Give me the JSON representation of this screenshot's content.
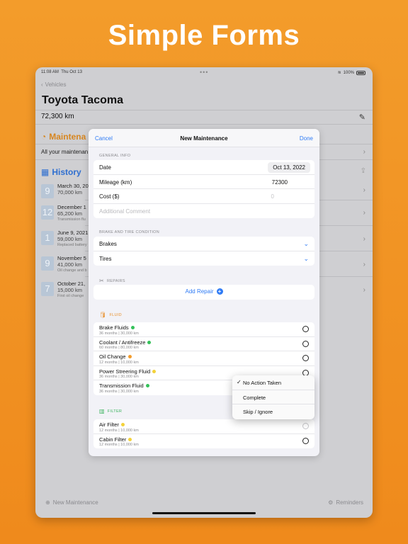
{
  "headline": "Simple Forms",
  "status": {
    "time": "11:08 AM",
    "date": "Thu Oct 13",
    "battery": "100%"
  },
  "background": {
    "back_label": "Vehicles",
    "vehicle_title": "Toyota Tacoma",
    "mileage": "72,300 km",
    "maintenance_heading": "Maintena",
    "maintenance_sub": "All your maintenan",
    "history_heading": "History",
    "history": [
      {
        "day": "9",
        "date": "March 30, 20",
        "km": "70,000 km",
        "note": ""
      },
      {
        "day": "12",
        "date": "December 1",
        "km": "65,200 km",
        "note": "Transmission flu"
      },
      {
        "day": "1",
        "date": "June 9, 2021",
        "km": "59,000 km",
        "note": "Replaced battery"
      },
      {
        "day": "9",
        "date": "November 5",
        "km": "41,000 km",
        "note": "Oil change and b"
      },
      {
        "day": "7",
        "date": "October 21,",
        "km": "15,000 km",
        "note": "First oil change"
      }
    ],
    "bottom_left": "New Maintenance",
    "bottom_right": "Reminders"
  },
  "modal": {
    "cancel": "Cancel",
    "title": "New Maintenance",
    "done": "Done",
    "general_info_label": "GENERAL INFO",
    "date_label": "Date",
    "date_value": "Oct 13, 2022",
    "mileage_label": "Mileage (km)",
    "mileage_value": "72300",
    "cost_label": "Cost ($)",
    "cost_placeholder": "0",
    "comment_placeholder": "Additional Comment",
    "brake_label": "BRAKE AND TIRE CONDITION",
    "brakes": "Brakes",
    "tires": "Tires",
    "repairs_label": "REPAIRS",
    "add_repair": "Add Repair",
    "fluid_label": "FLUID",
    "fluids": [
      {
        "name": "Brake Fluids",
        "sub": "36 months | 30,000 km",
        "status": "green"
      },
      {
        "name": "Coolant / Antifreeze",
        "sub": "60 months | 80,000 km",
        "status": "green"
      },
      {
        "name": "Oil Change",
        "sub": "12 months | 10,000 km",
        "status": "orange"
      },
      {
        "name": "Power Streering Fluid",
        "sub": "36 months | 30,000 km",
        "status": "yellow"
      },
      {
        "name": "Transmission Fluid",
        "sub": "36 months | 30,000 km",
        "status": "green"
      }
    ],
    "filter_label": "FILTER",
    "filters": [
      {
        "name": "Air Filter",
        "sub": "12 months | 10,000 km",
        "status": "yellow"
      },
      {
        "name": "Cabin Filter",
        "sub": "12 months | 10,000 km",
        "status": "yellow"
      }
    ]
  },
  "popup": {
    "items": [
      "No Action Taken",
      "Complete",
      "Skip / Ignore"
    ],
    "selected": "No Action Taken"
  },
  "colors": {
    "accent": "#2f7bf5",
    "orange": "#f39c2b",
    "green": "#35c15a",
    "yellow": "#f3d23a"
  }
}
